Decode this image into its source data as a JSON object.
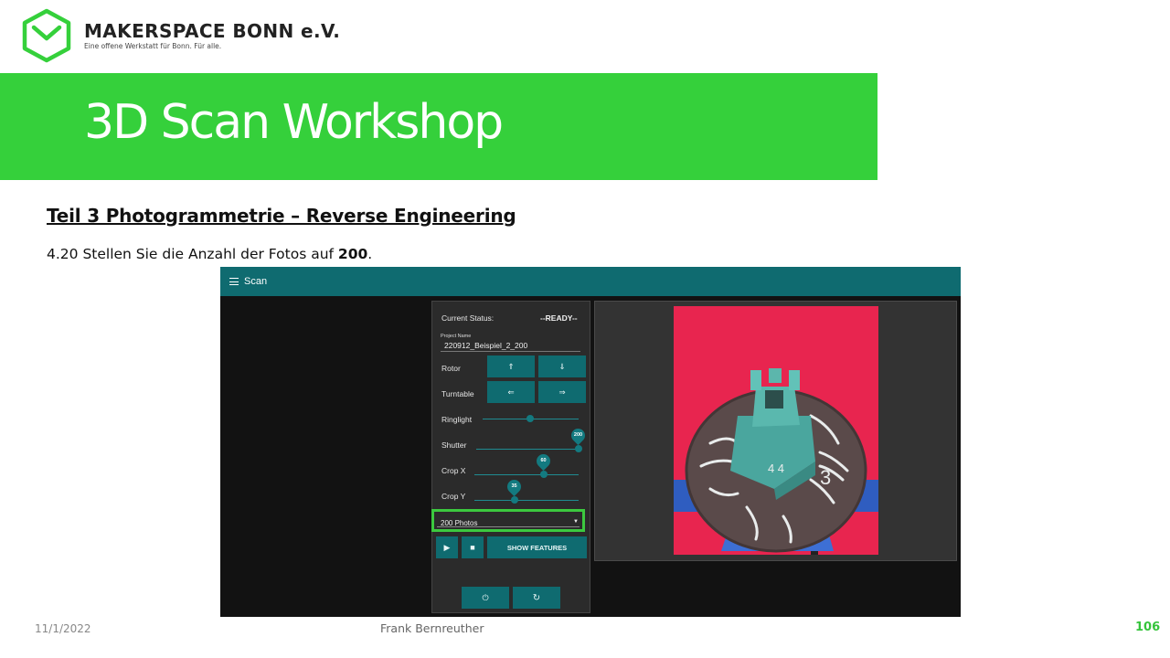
{
  "brand": {
    "name": "MAKERSPACE BONN e.V.",
    "tagline": "Eine offene Werkstatt für Bonn. Für alle."
  },
  "slide": {
    "title": "3D Scan Workshop",
    "subtitle": "Teil 3  Photogrammetrie  – Reverse Engineering",
    "instruction_prefix": "4.20 Stellen Sie die Anzahl der Fotos auf ",
    "instruction_value": "200",
    "instruction_suffix": "."
  },
  "footer": {
    "date": "11/1/2022",
    "author": "Frank Bernreuther",
    "page": "106"
  },
  "app": {
    "title": "Scan",
    "status_label": "Current Status:",
    "status_value": "--READY--",
    "project_label": "Project Name",
    "project_value": "220912_Beispiel_2_200",
    "rotor_label": "Rotor",
    "rotor_up": "⇑",
    "rotor_down": "⇓",
    "turntable_label": "Turntable",
    "turntable_left": "⇐",
    "turntable_right": "⇒",
    "ringlight_label": "Ringlight",
    "ringlight_level": 0.5,
    "shutter_label": "Shutter",
    "shutter_value": "200",
    "cropx_label": "Crop X",
    "cropx_value": "60",
    "cropy_label": "Crop Y",
    "cropy_value": "35",
    "photos_selected": "200 Photos",
    "play_icon": "▶",
    "stop_icon": "■",
    "show_features_label": "SHOW FEATURES",
    "power_icon": "⏻",
    "refresh_icon": "↻",
    "colors": {
      "app_bar": "#0f6b70",
      "accent": "#137a80",
      "highlight": "#3cc93f",
      "brand_green": "#35d03b"
    }
  }
}
